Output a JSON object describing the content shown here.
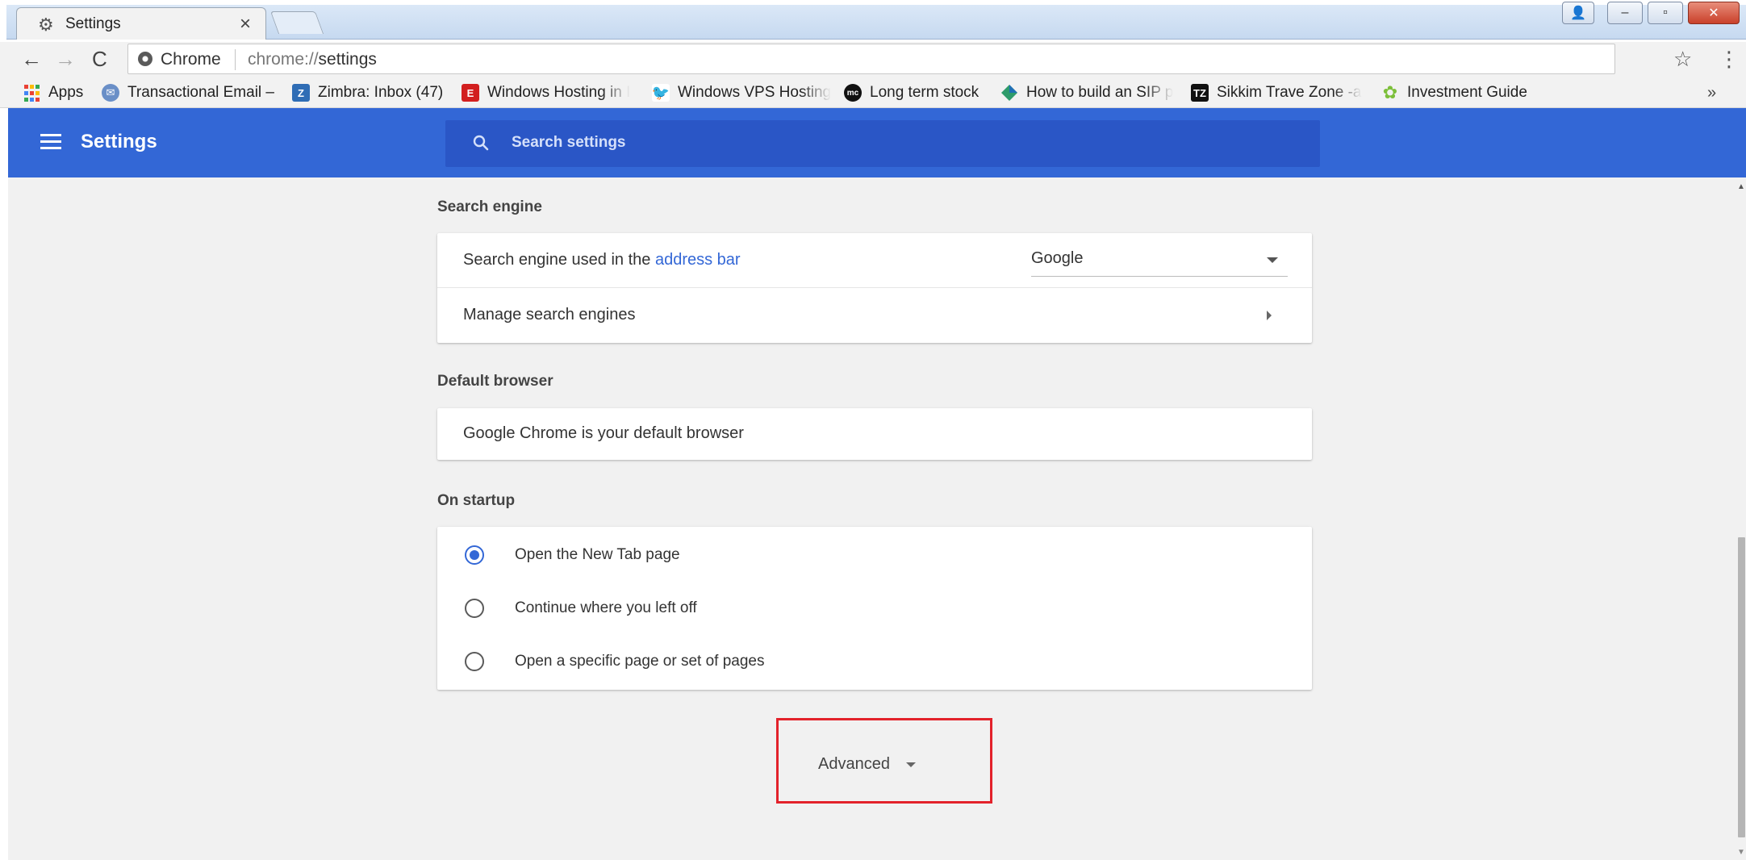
{
  "window": {
    "tab_title": "Settings",
    "tab_close": "×",
    "controls": {
      "user": "👤",
      "minimize": "–",
      "maximize": "▫",
      "close": "✕"
    }
  },
  "toolbar": {
    "back": "←",
    "forward": "→",
    "reload": "C",
    "origin_chip": "Chrome",
    "url_scheme": "chrome://",
    "url_path": "settings",
    "star": "☆",
    "menu": "⋮"
  },
  "bookmarks": {
    "items": [
      {
        "label": "Apps",
        "icon": "apps-grid-icon",
        "color": "#e94235"
      },
      {
        "label": "Transactional Email –",
        "icon": "mail-icon",
        "color": "#6a8fc7"
      },
      {
        "label": "Zimbra: Inbox (47)",
        "icon": "zimbra-icon",
        "color": "#2f6db5"
      },
      {
        "label": "Windows Hosting in I",
        "icon": "e-icon",
        "color": "#d21f1f"
      },
      {
        "label": "Windows VPS Hosting",
        "icon": "bird-icon",
        "color": "#4a8f3b"
      },
      {
        "label": "Long term stock",
        "icon": "moneycontrol-icon",
        "color": "#111111"
      },
      {
        "label": "How to build an SIP p",
        "icon": "diamond-icon",
        "color": "#2e9b6b"
      },
      {
        "label": "Sikkim Trave Zone -a",
        "icon": "tz-icon",
        "color": "#111111"
      },
      {
        "label": "Investment Guide",
        "icon": "clover-icon",
        "color": "#7cbf3a"
      }
    ],
    "overflow": "»"
  },
  "header": {
    "title": "Settings",
    "search_placeholder": "Search settings"
  },
  "search_engine": {
    "section_title": "Search engine",
    "used_in_prefix": "Search engine used in the ",
    "used_in_link": "address bar",
    "selected_engine": "Google",
    "manage_label": "Manage search engines"
  },
  "default_browser": {
    "section_title": "Default browser",
    "status": "Google Chrome is your default browser"
  },
  "on_startup": {
    "section_title": "On startup",
    "options": [
      {
        "label": "Open the New Tab page",
        "checked": true
      },
      {
        "label": "Continue where you left off",
        "checked": false
      },
      {
        "label": "Open a specific page or set of pages",
        "checked": false
      }
    ]
  },
  "advanced": {
    "label": "Advanced"
  },
  "colors": {
    "header_blue": "#3367d6",
    "search_blue": "#2a56c6",
    "highlight_red": "#e3222b"
  }
}
